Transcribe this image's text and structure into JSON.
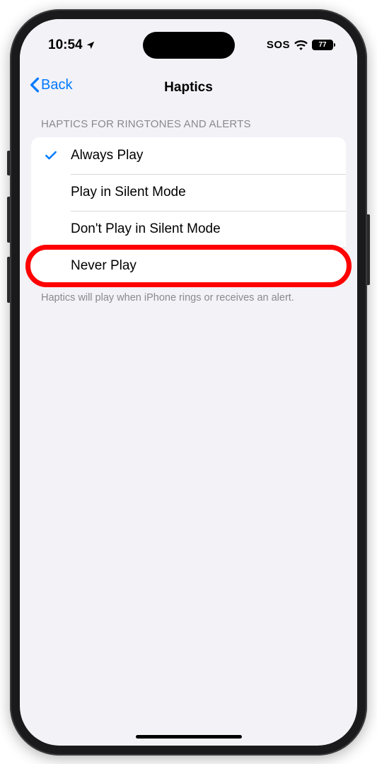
{
  "statusBar": {
    "time": "10:54",
    "sos": "SOS",
    "battery": "77"
  },
  "nav": {
    "back": "Back",
    "title": "Haptics"
  },
  "section": {
    "header": "HAPTICS FOR RINGTONES AND ALERTS",
    "footer": "Haptics will play when iPhone rings or receives an alert."
  },
  "options": [
    {
      "label": "Always Play",
      "selected": true,
      "highlighted": false
    },
    {
      "label": "Play in Silent Mode",
      "selected": false,
      "highlighted": false
    },
    {
      "label": "Don't Play in Silent Mode",
      "selected": false,
      "highlighted": false
    },
    {
      "label": "Never Play",
      "selected": false,
      "highlighted": true
    }
  ]
}
